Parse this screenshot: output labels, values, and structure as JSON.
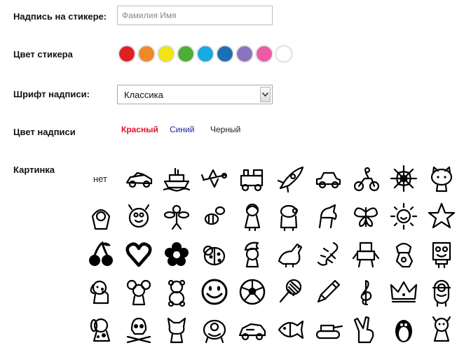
{
  "labels": {
    "text": "Надпись на стикере:",
    "color": "Цвет стикера",
    "font": "Шрифт надписи:",
    "textColor": "Цвет надписи",
    "picture": "Картинка"
  },
  "nameInput": {
    "placeholder": "Фамилия Имя",
    "value": ""
  },
  "stickerColors": [
    "#e02020",
    "#ef8a25",
    "#f4e416",
    "#4caf34",
    "#17a9e1",
    "#1a6fb7",
    "#8a74c0",
    "#ec5aa8",
    "#ffffff"
  ],
  "fontSelect": {
    "selected": "Классика"
  },
  "textColors": [
    {
      "label": "Красный",
      "color": "#e0152a",
      "selected": true
    },
    {
      "label": "Синий",
      "color": "#2020a8",
      "selected": false
    },
    {
      "label": "Черный",
      "color": "#222222",
      "selected": false
    }
  ],
  "pictureNone": "нет",
  "pictures": [
    [
      "racing-car",
      "ship",
      "airplane",
      "locomotive",
      "rocket",
      "small-car",
      "bicycle-rider",
      "spider-web",
      "hello-kitty"
    ],
    [
      "masha",
      "smeshariki",
      "bee-fairy",
      "bees",
      "dora",
      "peppa-pig",
      "pony",
      "butterfly",
      "sun",
      "starfish"
    ],
    [
      "cherries",
      "heart",
      "flower",
      "ladybug",
      "smurf",
      "dinosaur",
      "lizard",
      "robot-warrior",
      "ben10",
      "spongebob"
    ],
    [
      "puppy",
      "jerry-mouse",
      "teddy-bear",
      "smiley",
      "soccer-ball",
      "tennis-racket",
      "pencil",
      "treble-clef",
      "crown",
      "minion"
    ],
    [
      "blues-clues-dog",
      "skull",
      "cartoon-cat",
      "monster",
      "lightning-mcqueen",
      "flounder-fish",
      "tank",
      "victory-hand",
      "penguin",
      "fixie"
    ]
  ]
}
